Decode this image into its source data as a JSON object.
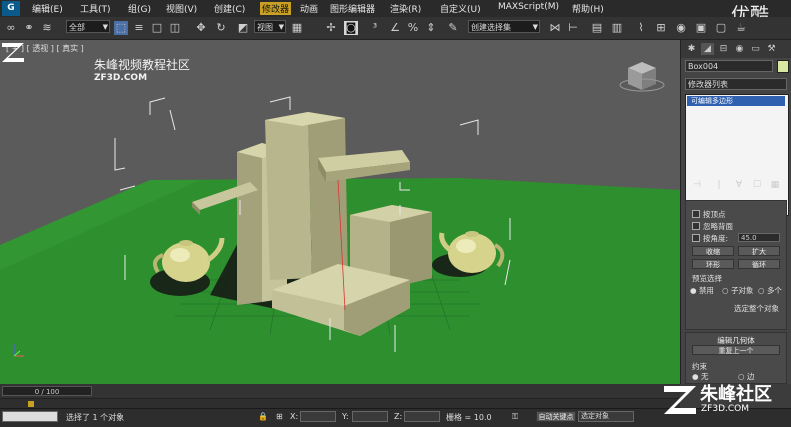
{
  "menu": {
    "items": [
      "编辑(E)",
      "工具(T)",
      "组(G)",
      "视图(V)",
      "创建(C)",
      "修改器",
      "动画",
      "图形编辑器",
      "渲染(R)",
      "自定义(U)",
      "MAXScript(M)",
      "帮助(H)"
    ],
    "active_index": 5
  },
  "watermark_top": "优酷",
  "toolbar": {
    "selection_filter": "全部",
    "reference_coord": "视图",
    "named_selection": "创建选择集"
  },
  "viewport": {
    "label": "[ + ] [ 透视 ] [ 真实 ]",
    "watermark_title": "朱峰视频教程社区",
    "watermark_sub": "ZF3D.COM",
    "colors": {
      "background": "#5b5b5b",
      "ground": "#2e8f2e",
      "objects": "#b8b68a",
      "teapot": "#d6d48c",
      "bbox": "#e8e8e8"
    }
  },
  "panel": {
    "object_name": "Box004",
    "modifier_list": "修改器列表",
    "stack_item": "可编辑多边形",
    "selection": {
      "by_vertex": "按顶点",
      "ignore_backface": "忽略背面",
      "by_angle": "按角度:",
      "angle_value": "45.0",
      "shrink": "收缩",
      "grow": "扩大",
      "ring": "环形",
      "loop": "循环",
      "preview_selection": "预览选择",
      "disabled": "禁用",
      "subobject": "子对象",
      "multi": "多个",
      "selected_count": "选定整个对象"
    },
    "edit_geometry": {
      "title": "编辑几何体",
      "repeat_last": "重复上一个",
      "constraints": "约束",
      "none": "无",
      "edge": "边"
    }
  },
  "timeline": {
    "frame": "0 / 100"
  },
  "status": {
    "message": "选择了 1 个对象",
    "x_label": "X:",
    "y_label": "Y:",
    "z_label": "Z:",
    "grid": "栅格 = 10.0",
    "auto_key": "自动关键点",
    "selected_obj": "选定对象"
  },
  "watermark_bottom": {
    "title": "朱峰社区",
    "url": "ZF3D.COM"
  }
}
